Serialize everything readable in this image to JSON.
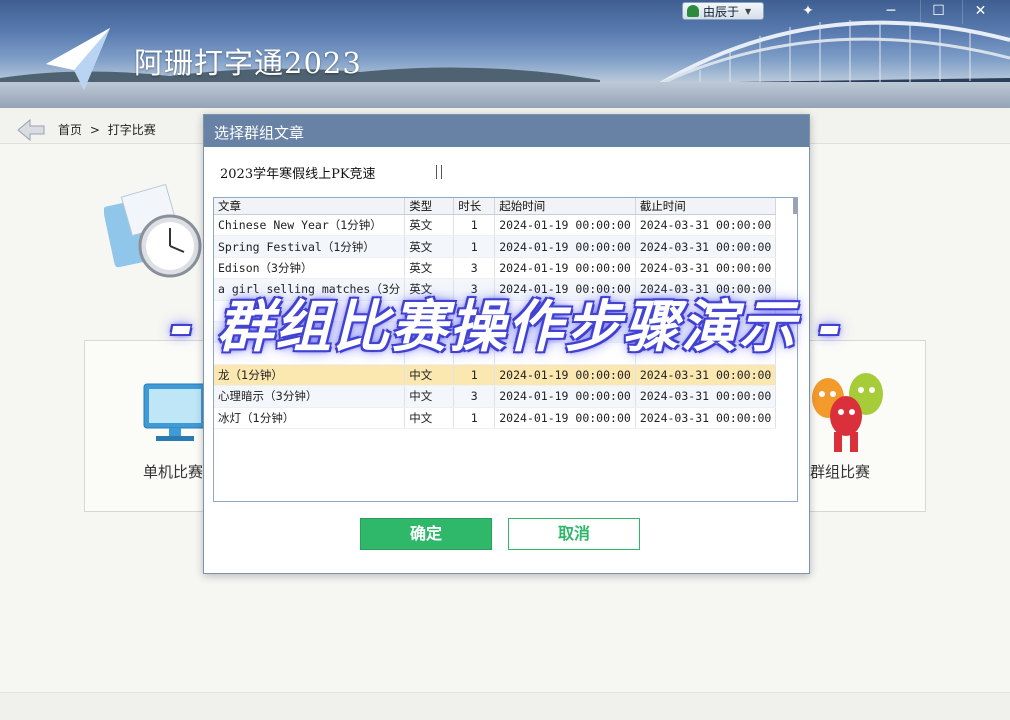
{
  "app": {
    "title": "阿珊打字通2023"
  },
  "user": {
    "name": "由辰于"
  },
  "breadcrumb": {
    "home": "首页",
    "separator": ">",
    "current": "打字比赛"
  },
  "modes": {
    "single": "单机比赛",
    "group": "群组比赛"
  },
  "dialog": {
    "title": "选择群组文章",
    "group_name": "2023学年寒假线上PK竞速",
    "columns": [
      "文章",
      "类型",
      "时长",
      "起始时间",
      "截止时间"
    ],
    "rows": [
      [
        "Chinese New Year（1分钟）",
        "英文",
        "1",
        "2024-01-19 00:00:00",
        "2024-03-31 00:00:00"
      ],
      [
        "Spring Festival（1分钟）",
        "英文",
        "1",
        "2024-01-19 00:00:00",
        "2024-03-31 00:00:00"
      ],
      [
        "Edison（3分钟）",
        "英文",
        "3",
        "2024-01-19 00:00:00",
        "2024-03-31 00:00:00"
      ],
      [
        "a girl selling matches（3分",
        "英文",
        "3",
        "2024-01-19 00:00:00",
        "2024-03-31 00:00:00"
      ],
      [
        "",
        "",
        "",
        "",
        ""
      ],
      [
        "",
        "",
        "",
        "",
        ""
      ],
      [
        "",
        "",
        "",
        "",
        ""
      ],
      [
        "龙（1分钟）",
        "中文",
        "1",
        "2024-01-19 00:00:00",
        "2024-03-31 00:00:00"
      ],
      [
        "心理暗示（3分钟）",
        "中文",
        "3",
        "2024-01-19 00:00:00",
        "2024-03-31 00:00:00"
      ],
      [
        "冰灯（1分钟）",
        "中文",
        "1",
        "2024-01-19 00:00:00",
        "2024-03-31 00:00:00"
      ]
    ],
    "selected_row": 7,
    "ok_label": "确定",
    "cancel_label": "取消"
  },
  "overlay_caption": "- 群组比赛操作步骤演示 -",
  "colors": {
    "accent_green": "#2fb86a",
    "title_bar": "#6882a6",
    "selected_row": "#fbe7b0",
    "caption_outline": "#3a3acb"
  }
}
